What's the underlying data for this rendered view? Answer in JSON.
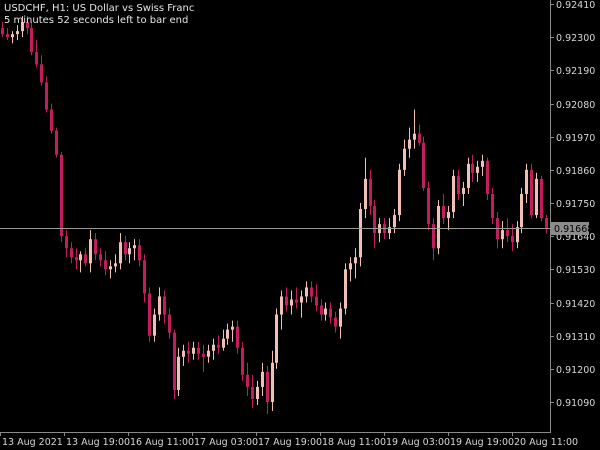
{
  "header": {
    "symbol_line": "USDCHF, H1:  US Dollar vs Swiss Franc",
    "timer_line": "5 minutes 52 seconds left to bar end"
  },
  "colors": {
    "background": "#000000",
    "bull_candle": "#f0c0b4",
    "bear_candle": "#c21d5c",
    "axis": "#8a8a8a",
    "text": "#d6d6d6",
    "price_line": "#9a9a9a",
    "price_label_bg": "#8c8c8c"
  },
  "chart_data": {
    "type": "candlestick",
    "y_ticks": [
      "0.92410",
      "0.92300",
      "0.92190",
      "0.92080",
      "0.91970",
      "0.91860",
      "0.91750",
      "0.91640",
      "0.91530",
      "0.91420",
      "0.91310",
      "0.91200",
      "0.91090"
    ],
    "x_ticks": [
      "13 Aug 2021",
      "13 Aug 19:00",
      "16 Aug 11:00",
      "17 Aug 03:00",
      "17 Aug 19:00",
      "18 Aug 11:00",
      "19 Aug 03:00",
      "19 Aug 19:00",
      "20 Aug 11:00"
    ],
    "ylim": [
      0.9103,
      0.9241
    ],
    "current_price": "0.91668",
    "candles": [
      {
        "o": 0.9233,
        "h": 0.9235,
        "l": 0.923,
        "c": 0.9231
      },
      {
        "o": 0.9231,
        "h": 0.9233,
        "l": 0.9229,
        "c": 0.923
      },
      {
        "o": 0.923,
        "h": 0.9232,
        "l": 0.9228,
        "c": 0.9231
      },
      {
        "o": 0.9231,
        "h": 0.9234,
        "l": 0.9229,
        "c": 0.9232
      },
      {
        "o": 0.9232,
        "h": 0.9237,
        "l": 0.923,
        "c": 0.9235
      },
      {
        "o": 0.9235,
        "h": 0.9237,
        "l": 0.9231,
        "c": 0.9233
      },
      {
        "o": 0.9233,
        "h": 0.9235,
        "l": 0.9224,
        "c": 0.9225
      },
      {
        "o": 0.9225,
        "h": 0.9229,
        "l": 0.922,
        "c": 0.9221
      },
      {
        "o": 0.9221,
        "h": 0.9224,
        "l": 0.9214,
        "c": 0.9215
      },
      {
        "o": 0.9215,
        "h": 0.9217,
        "l": 0.9205,
        "c": 0.9206
      },
      {
        "o": 0.9206,
        "h": 0.9208,
        "l": 0.9198,
        "c": 0.9199
      },
      {
        "o": 0.9199,
        "h": 0.92,
        "l": 0.919,
        "c": 0.9191
      },
      {
        "o": 0.9191,
        "h": 0.9192,
        "l": 0.9162,
        "c": 0.9164
      },
      {
        "o": 0.9164,
        "h": 0.9166,
        "l": 0.9157,
        "c": 0.916
      },
      {
        "o": 0.916,
        "h": 0.9162,
        "l": 0.9155,
        "c": 0.9157
      },
      {
        "o": 0.9157,
        "h": 0.916,
        "l": 0.9153,
        "c": 0.9156
      },
      {
        "o": 0.9156,
        "h": 0.9159,
        "l": 0.9152,
        "c": 0.9158
      },
      {
        "o": 0.9158,
        "h": 0.916,
        "l": 0.9154,
        "c": 0.9155
      },
      {
        "o": 0.9155,
        "h": 0.9166,
        "l": 0.9152,
        "c": 0.9163
      },
      {
        "o": 0.9163,
        "h": 0.9165,
        "l": 0.9156,
        "c": 0.9158
      },
      {
        "o": 0.9158,
        "h": 0.916,
        "l": 0.9154,
        "c": 0.9156
      },
      {
        "o": 0.9156,
        "h": 0.9159,
        "l": 0.9151,
        "c": 0.9153
      },
      {
        "o": 0.9153,
        "h": 0.9156,
        "l": 0.915,
        "c": 0.9154
      },
      {
        "o": 0.9154,
        "h": 0.9158,
        "l": 0.9152,
        "c": 0.9155
      },
      {
        "o": 0.9155,
        "h": 0.9165,
        "l": 0.9153,
        "c": 0.9162
      },
      {
        "o": 0.9162,
        "h": 0.9164,
        "l": 0.9156,
        "c": 0.9158
      },
      {
        "o": 0.9158,
        "h": 0.9162,
        "l": 0.9155,
        "c": 0.916
      },
      {
        "o": 0.916,
        "h": 0.9163,
        "l": 0.9156,
        "c": 0.9161
      },
      {
        "o": 0.9161,
        "h": 0.9163,
        "l": 0.9154,
        "c": 0.9156
      },
      {
        "o": 0.9156,
        "h": 0.9158,
        "l": 0.9142,
        "c": 0.9145
      },
      {
        "o": 0.9145,
        "h": 0.9147,
        "l": 0.9129,
        "c": 0.9131
      },
      {
        "o": 0.9131,
        "h": 0.914,
        "l": 0.9129,
        "c": 0.9138
      },
      {
        "o": 0.9138,
        "h": 0.9147,
        "l": 0.9136,
        "c": 0.9144
      },
      {
        "o": 0.9144,
        "h": 0.9146,
        "l": 0.9135,
        "c": 0.9138
      },
      {
        "o": 0.9138,
        "h": 0.914,
        "l": 0.913,
        "c": 0.9132
      },
      {
        "o": 0.9132,
        "h": 0.9133,
        "l": 0.911,
        "c": 0.9113
      },
      {
        "o": 0.9113,
        "h": 0.9127,
        "l": 0.9111,
        "c": 0.9124
      },
      {
        "o": 0.9124,
        "h": 0.9128,
        "l": 0.9121,
        "c": 0.9126
      },
      {
        "o": 0.9126,
        "h": 0.9129,
        "l": 0.9122,
        "c": 0.9125
      },
      {
        "o": 0.9125,
        "h": 0.9129,
        "l": 0.9123,
        "c": 0.9127
      },
      {
        "o": 0.9127,
        "h": 0.9129,
        "l": 0.9123,
        "c": 0.9125
      },
      {
        "o": 0.9125,
        "h": 0.9128,
        "l": 0.9119,
        "c": 0.9124
      },
      {
        "o": 0.9124,
        "h": 0.9128,
        "l": 0.9122,
        "c": 0.9126
      },
      {
        "o": 0.9126,
        "h": 0.913,
        "l": 0.9123,
        "c": 0.9128
      },
      {
        "o": 0.9128,
        "h": 0.9131,
        "l": 0.9125,
        "c": 0.9127
      },
      {
        "o": 0.9127,
        "h": 0.9133,
        "l": 0.9126,
        "c": 0.913
      },
      {
        "o": 0.913,
        "h": 0.9135,
        "l": 0.9128,
        "c": 0.9133
      },
      {
        "o": 0.9133,
        "h": 0.9136,
        "l": 0.9129,
        "c": 0.9134
      },
      {
        "o": 0.9134,
        "h": 0.9136,
        "l": 0.9125,
        "c": 0.9127
      },
      {
        "o": 0.9127,
        "h": 0.9129,
        "l": 0.9116,
        "c": 0.9118
      },
      {
        "o": 0.9118,
        "h": 0.9122,
        "l": 0.9111,
        "c": 0.9114
      },
      {
        "o": 0.9114,
        "h": 0.9118,
        "l": 0.9107,
        "c": 0.911
      },
      {
        "o": 0.911,
        "h": 0.9116,
        "l": 0.9108,
        "c": 0.9114
      },
      {
        "o": 0.9114,
        "h": 0.9122,
        "l": 0.9111,
        "c": 0.9119
      },
      {
        "o": 0.9119,
        "h": 0.9121,
        "l": 0.9105,
        "c": 0.9109
      },
      {
        "o": 0.9109,
        "h": 0.9126,
        "l": 0.9106,
        "c": 0.9122
      },
      {
        "o": 0.9122,
        "h": 0.914,
        "l": 0.912,
        "c": 0.9138
      },
      {
        "o": 0.9138,
        "h": 0.9146,
        "l": 0.9133,
        "c": 0.9144
      },
      {
        "o": 0.9144,
        "h": 0.9147,
        "l": 0.9139,
        "c": 0.9141
      },
      {
        "o": 0.9141,
        "h": 0.9146,
        "l": 0.9138,
        "c": 0.9143
      },
      {
        "o": 0.9143,
        "h": 0.9147,
        "l": 0.914,
        "c": 0.9142
      },
      {
        "o": 0.9142,
        "h": 0.9146,
        "l": 0.9137,
        "c": 0.9144
      },
      {
        "o": 0.9144,
        "h": 0.9149,
        "l": 0.9142,
        "c": 0.9147
      },
      {
        "o": 0.9147,
        "h": 0.9149,
        "l": 0.9142,
        "c": 0.9144
      },
      {
        "o": 0.9144,
        "h": 0.9148,
        "l": 0.9139,
        "c": 0.9141
      },
      {
        "o": 0.9141,
        "h": 0.9143,
        "l": 0.9136,
        "c": 0.9138
      },
      {
        "o": 0.9138,
        "h": 0.9142,
        "l": 0.9136,
        "c": 0.914
      },
      {
        "o": 0.914,
        "h": 0.9142,
        "l": 0.9135,
        "c": 0.9137
      },
      {
        "o": 0.9137,
        "h": 0.9139,
        "l": 0.9132,
        "c": 0.9134
      },
      {
        "o": 0.9134,
        "h": 0.9142,
        "l": 0.913,
        "c": 0.914
      },
      {
        "o": 0.914,
        "h": 0.9155,
        "l": 0.9138,
        "c": 0.9153
      },
      {
        "o": 0.9153,
        "h": 0.9157,
        "l": 0.9149,
        "c": 0.9155
      },
      {
        "o": 0.9155,
        "h": 0.916,
        "l": 0.915,
        "c": 0.9157
      },
      {
        "o": 0.9157,
        "h": 0.9175,
        "l": 0.9154,
        "c": 0.9173
      },
      {
        "o": 0.9173,
        "h": 0.919,
        "l": 0.917,
        "c": 0.9183
      },
      {
        "o": 0.9183,
        "h": 0.9186,
        "l": 0.9171,
        "c": 0.9174
      },
      {
        "o": 0.9174,
        "h": 0.9176,
        "l": 0.916,
        "c": 0.9165
      },
      {
        "o": 0.9165,
        "h": 0.917,
        "l": 0.9162,
        "c": 0.9168
      },
      {
        "o": 0.9168,
        "h": 0.917,
        "l": 0.9163,
        "c": 0.9165
      },
      {
        "o": 0.9165,
        "h": 0.917,
        "l": 0.9163,
        "c": 0.9167
      },
      {
        "o": 0.9167,
        "h": 0.9173,
        "l": 0.9165,
        "c": 0.9171
      },
      {
        "o": 0.9171,
        "h": 0.9188,
        "l": 0.9169,
        "c": 0.9186
      },
      {
        "o": 0.9186,
        "h": 0.9196,
        "l": 0.9184,
        "c": 0.9193
      },
      {
        "o": 0.9193,
        "h": 0.92,
        "l": 0.919,
        "c": 0.9196
      },
      {
        "o": 0.9196,
        "h": 0.9206,
        "l": 0.9193,
        "c": 0.9198
      },
      {
        "o": 0.9198,
        "h": 0.9201,
        "l": 0.9194,
        "c": 0.9195
      },
      {
        "o": 0.9195,
        "h": 0.9197,
        "l": 0.9179,
        "c": 0.918
      },
      {
        "o": 0.918,
        "h": 0.9182,
        "l": 0.9166,
        "c": 0.9168
      },
      {
        "o": 0.9168,
        "h": 0.917,
        "l": 0.9156,
        "c": 0.916
      },
      {
        "o": 0.916,
        "h": 0.9176,
        "l": 0.9158,
        "c": 0.9174
      },
      {
        "o": 0.9174,
        "h": 0.9178,
        "l": 0.9168,
        "c": 0.917
      },
      {
        "o": 0.917,
        "h": 0.9174,
        "l": 0.9166,
        "c": 0.9172
      },
      {
        "o": 0.9172,
        "h": 0.9186,
        "l": 0.917,
        "c": 0.9184
      },
      {
        "o": 0.9184,
        "h": 0.9186,
        "l": 0.9176,
        "c": 0.9178
      },
      {
        "o": 0.9178,
        "h": 0.9182,
        "l": 0.9174,
        "c": 0.918
      },
      {
        "o": 0.918,
        "h": 0.919,
        "l": 0.9178,
        "c": 0.9188
      },
      {
        "o": 0.9188,
        "h": 0.9191,
        "l": 0.9182,
        "c": 0.9185
      },
      {
        "o": 0.9185,
        "h": 0.9189,
        "l": 0.9182,
        "c": 0.9187
      },
      {
        "o": 0.9187,
        "h": 0.9191,
        "l": 0.9184,
        "c": 0.9189
      },
      {
        "o": 0.9189,
        "h": 0.919,
        "l": 0.9176,
        "c": 0.9178
      },
      {
        "o": 0.9178,
        "h": 0.918,
        "l": 0.9168,
        "c": 0.917
      },
      {
        "o": 0.917,
        "h": 0.9172,
        "l": 0.916,
        "c": 0.9163
      },
      {
        "o": 0.9163,
        "h": 0.9169,
        "l": 0.916,
        "c": 0.9166
      },
      {
        "o": 0.9166,
        "h": 0.917,
        "l": 0.9162,
        "c": 0.9164
      },
      {
        "o": 0.9164,
        "h": 0.9168,
        "l": 0.9159,
        "c": 0.9162
      },
      {
        "o": 0.9162,
        "h": 0.9169,
        "l": 0.916,
        "c": 0.9167
      },
      {
        "o": 0.9167,
        "h": 0.918,
        "l": 0.9165,
        "c": 0.9178
      },
      {
        "o": 0.9178,
        "h": 0.9188,
        "l": 0.9175,
        "c": 0.9186
      },
      {
        "o": 0.9186,
        "h": 0.9188,
        "l": 0.917,
        "c": 0.9171
      },
      {
        "o": 0.9171,
        "h": 0.9185,
        "l": 0.917,
        "c": 0.9183
      },
      {
        "o": 0.9183,
        "h": 0.9184,
        "l": 0.9169,
        "c": 0.917
      },
      {
        "o": 0.917,
        "h": 0.9171,
        "l": 0.9165,
        "c": 0.91668
      }
    ]
  }
}
